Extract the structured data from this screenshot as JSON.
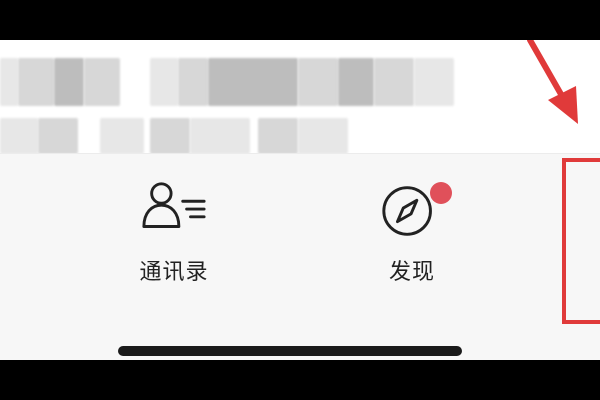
{
  "tabs": [
    {
      "label": "通讯录",
      "icon": "contacts-icon"
    },
    {
      "label": "发现",
      "icon": "compass-icon"
    }
  ],
  "colors": {
    "highlight_box": "#e03a3a",
    "badge": "#e0505a",
    "tabbar_bg": "#f7f7f7",
    "label_text": "#222222"
  },
  "annotations": {
    "arrow": "red-arrow",
    "box": "red-highlight-box"
  }
}
